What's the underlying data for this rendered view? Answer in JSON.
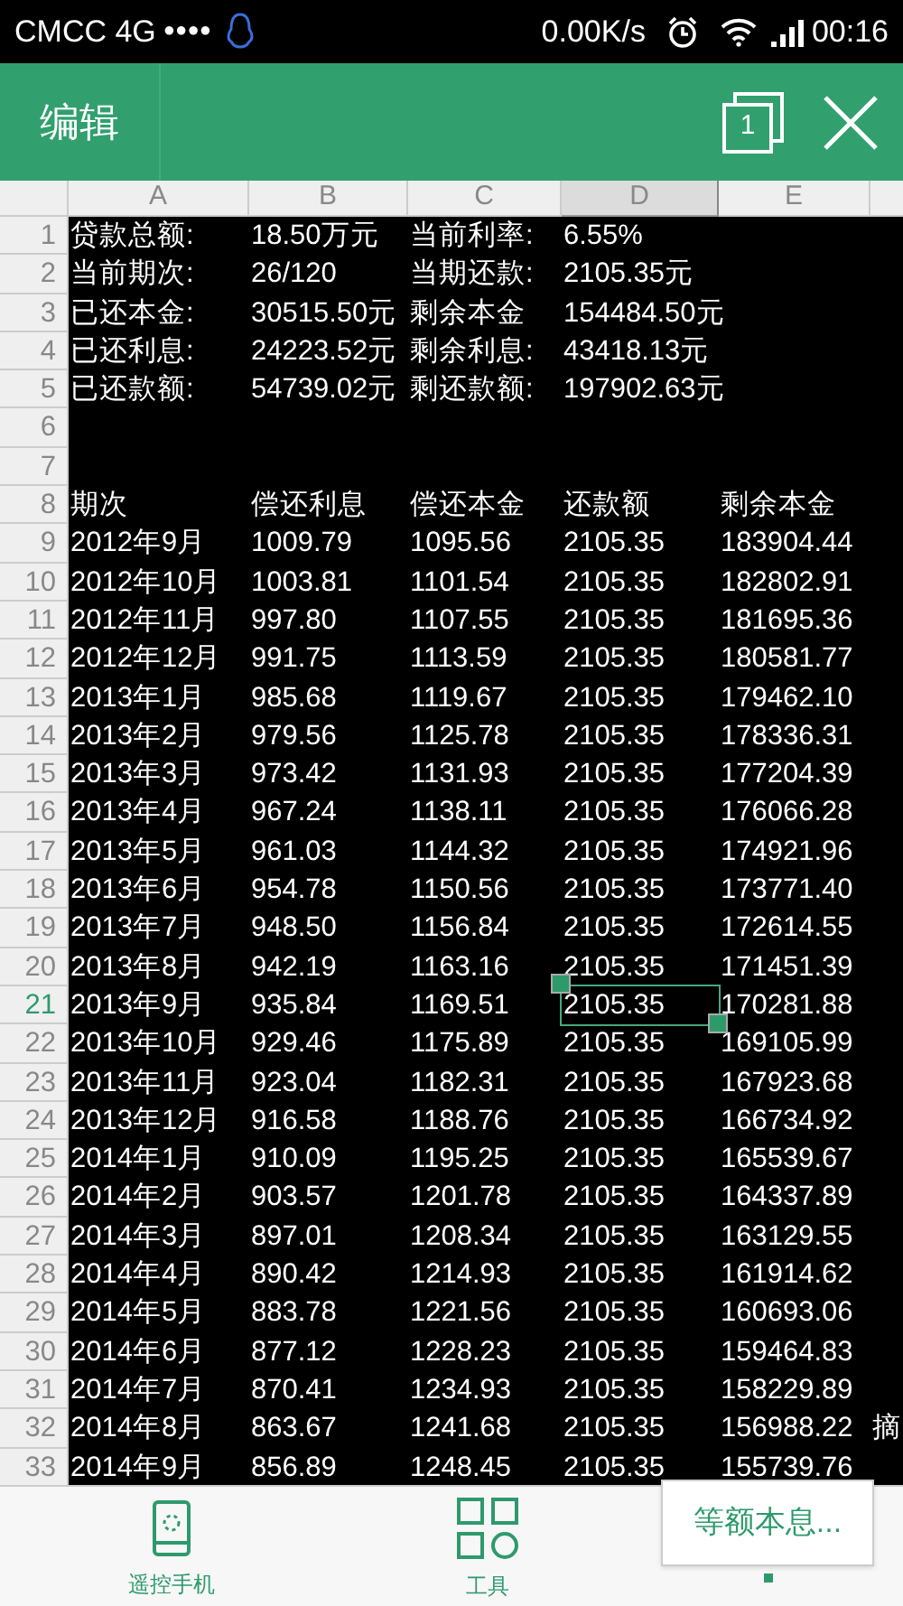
{
  "status_bar": {
    "carrier": "CMCC 4G",
    "signal_dots": "●●●●",
    "speed": "0.00K/s",
    "time": "00:16"
  },
  "toolbar": {
    "title": "编辑",
    "sheet_count": "1"
  },
  "columns": [
    {
      "label": "A",
      "selected": false
    },
    {
      "label": "B",
      "selected": false
    },
    {
      "label": "C",
      "selected": false
    },
    {
      "label": "D",
      "selected": true
    },
    {
      "label": "E",
      "selected": false
    }
  ],
  "rows": [
    {
      "number": "1",
      "selected": false,
      "cells": [
        "贷款总额:",
        "18.50万元",
        "当前利率:",
        "6.55%"
      ]
    },
    {
      "number": "2",
      "selected": false,
      "cells": [
        "当前期次:",
        "26/120",
        "当期还款:",
        "2105.35元"
      ]
    },
    {
      "number": "3",
      "selected": false,
      "cells": [
        "已还本金:",
        "30515.50元",
        "剩余本金",
        "154484.50元"
      ]
    },
    {
      "number": "4",
      "selected": false,
      "cells": [
        "已还利息:",
        "24223.52元",
        "剩余利息:",
        "43418.13元"
      ]
    },
    {
      "number": "5",
      "selected": false,
      "cells": [
        "已还款额:",
        "54739.02元",
        "剩还款额:",
        "197902.63元"
      ]
    },
    {
      "number": "6",
      "selected": false,
      "cells": []
    },
    {
      "number": "7",
      "selected": false,
      "cells": []
    },
    {
      "number": "8",
      "selected": false,
      "cells": [
        "期次",
        "偿还利息",
        "偿还本金",
        "还款额",
        "剩余本金"
      ]
    },
    {
      "number": "9",
      "selected": false,
      "cells": [
        "2012年9月",
        "1009.79",
        "1095.56",
        "2105.35",
        "183904.44"
      ]
    },
    {
      "number": "10",
      "selected": false,
      "cells": [
        "2012年10月",
        "1003.81",
        "1101.54",
        "2105.35",
        "182802.91"
      ]
    },
    {
      "number": "11",
      "selected": false,
      "cells": [
        "2012年11月",
        "997.80",
        "1107.55",
        "2105.35",
        "181695.36"
      ]
    },
    {
      "number": "12",
      "selected": false,
      "cells": [
        "2012年12月",
        "991.75",
        "1113.59",
        "2105.35",
        "180581.77"
      ]
    },
    {
      "number": "13",
      "selected": false,
      "cells": [
        "2013年1月",
        "985.68",
        "1119.67",
        "2105.35",
        "179462.10"
      ]
    },
    {
      "number": "14",
      "selected": false,
      "cells": [
        "2013年2月",
        "979.56",
        "1125.78",
        "2105.35",
        "178336.31"
      ]
    },
    {
      "number": "15",
      "selected": false,
      "cells": [
        "2013年3月",
        "973.42",
        "1131.93",
        "2105.35",
        "177204.39"
      ]
    },
    {
      "number": "16",
      "selected": false,
      "cells": [
        "2013年4月",
        "967.24",
        "1138.11",
        "2105.35",
        "176066.28"
      ]
    },
    {
      "number": "17",
      "selected": false,
      "cells": [
        "2013年5月",
        "961.03",
        "1144.32",
        "2105.35",
        "174921.96"
      ]
    },
    {
      "number": "18",
      "selected": false,
      "cells": [
        "2013年6月",
        "954.78",
        "1150.56",
        "2105.35",
        "173771.40"
      ]
    },
    {
      "number": "19",
      "selected": false,
      "cells": [
        "2013年7月",
        "948.50",
        "1156.84",
        "2105.35",
        "172614.55"
      ]
    },
    {
      "number": "20",
      "selected": false,
      "cells": [
        "2013年8月",
        "942.19",
        "1163.16",
        "2105.35",
        "171451.39"
      ]
    },
    {
      "number": "21",
      "selected": true,
      "cells": [
        "2013年9月",
        "935.84",
        "1169.51",
        "2105.35",
        "170281.88"
      ]
    },
    {
      "number": "22",
      "selected": false,
      "cells": [
        "2013年10月",
        "929.46",
        "1175.89",
        "2105.35",
        "169105.99"
      ]
    },
    {
      "number": "23",
      "selected": false,
      "cells": [
        "2013年11月",
        "923.04",
        "1182.31",
        "2105.35",
        "167923.68"
      ]
    },
    {
      "number": "24",
      "selected": false,
      "cells": [
        "2013年12月",
        "916.58",
        "1188.76",
        "2105.35",
        "166734.92"
      ]
    },
    {
      "number": "25",
      "selected": false,
      "cells": [
        "2014年1月",
        "910.09",
        "1195.25",
        "2105.35",
        "165539.67"
      ]
    },
    {
      "number": "26",
      "selected": false,
      "cells": [
        "2014年2月",
        "903.57",
        "1201.78",
        "2105.35",
        "164337.89"
      ]
    },
    {
      "number": "27",
      "selected": false,
      "cells": [
        "2014年3月",
        "897.01",
        "1208.34",
        "2105.35",
        "163129.55"
      ]
    },
    {
      "number": "28",
      "selected": false,
      "cells": [
        "2014年4月",
        "890.42",
        "1214.93",
        "2105.35",
        "161914.62"
      ]
    },
    {
      "number": "29",
      "selected": false,
      "cells": [
        "2014年5月",
        "883.78",
        "1221.56",
        "2105.35",
        "160693.06"
      ]
    },
    {
      "number": "30",
      "selected": false,
      "cells": [
        "2014年6月",
        "877.12",
        "1228.23",
        "2105.35",
        "159464.83"
      ]
    },
    {
      "number": "31",
      "selected": false,
      "cells": [
        "2014年7月",
        "870.41",
        "1234.93",
        "2105.35",
        "158229.89"
      ]
    },
    {
      "number": "32",
      "selected": false,
      "cells": [
        "2014年8月",
        "863.67",
        "1241.68",
        "2105.35",
        "156988.22",
        "摘"
      ]
    },
    {
      "number": "33",
      "selected": false,
      "cells": [
        "2014年9月",
        "856.89",
        "1248.45",
        "2105.35",
        "155739.76"
      ]
    }
  ],
  "bottom_bar": {
    "items": [
      {
        "label": "遥控手机",
        "kind": "remote"
      },
      {
        "label": "工具",
        "kind": "tools"
      }
    ],
    "sheet_tab": {
      "label": "等额本息...",
      "selected": true
    }
  }
}
